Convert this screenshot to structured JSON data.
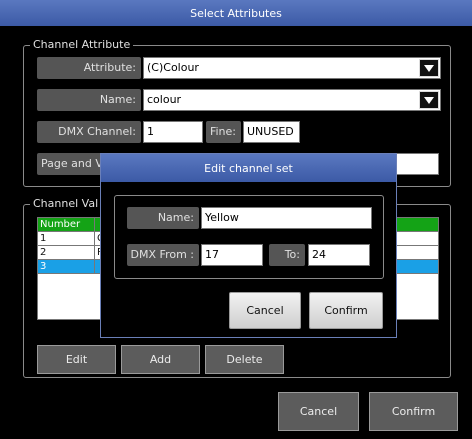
{
  "window": {
    "title": "Select Attributes"
  },
  "channel_attribute": {
    "legend": "Channel Attribute",
    "attribute_label": "Attribute:",
    "attribute_value": "(C)Colour",
    "name_label": "Name:",
    "name_value": "colour",
    "dmx_channel_label": "DMX Channel:",
    "dmx_channel_value": "1",
    "fine_label": "Fine:",
    "fine_value": "UNUSED",
    "page_label": "Page and V"
  },
  "channel_values": {
    "legend": "Channel Val",
    "table": {
      "header": "Number",
      "rows": [
        {
          "number": "1",
          "value": "C"
        },
        {
          "number": "2",
          "value": "R"
        },
        {
          "number": "3",
          "value": ""
        }
      ]
    },
    "edit_label": "Edit",
    "add_label": "Add",
    "delete_label": "Delete"
  },
  "footer": {
    "cancel_label": "Cancel",
    "confirm_label": "Confirm"
  },
  "dialog": {
    "title": "Edit channel set",
    "name_label": "Name:",
    "name_value": "Yellow",
    "dmx_from_label": "DMX From :",
    "dmx_from_value": "17",
    "to_label": "To:",
    "to_value": "24",
    "cancel_label": "Cancel",
    "confirm_label": "Confirm"
  },
  "colors": {
    "titlebar": "#3c5aa6",
    "label_bg": "#555555",
    "table_header": "#14a316",
    "selected_row": "#1aa0e6"
  }
}
